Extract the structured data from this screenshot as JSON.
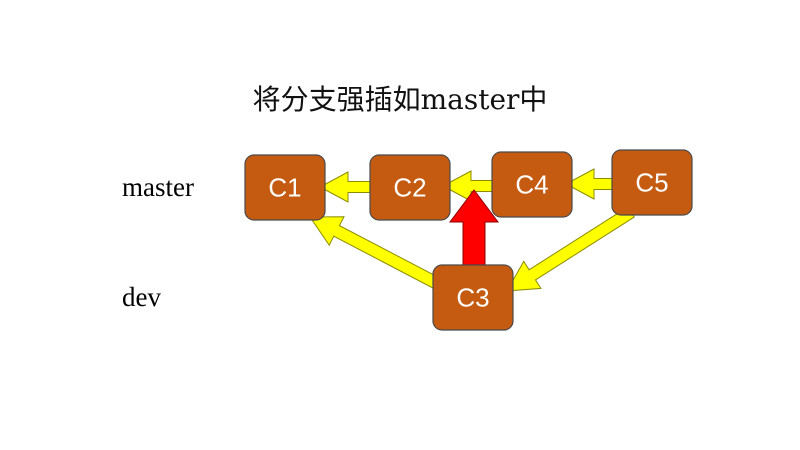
{
  "title": "将分支强插如master中",
  "rows": {
    "master": "master",
    "dev": "dev"
  },
  "commits": [
    {
      "id": "C1",
      "label": "C1",
      "branch": "master"
    },
    {
      "id": "C2",
      "label": "C2",
      "branch": "master"
    },
    {
      "id": "C4",
      "label": "C4",
      "branch": "master"
    },
    {
      "id": "C5",
      "label": "C5",
      "branch": "master"
    },
    {
      "id": "C3",
      "label": "C3",
      "branch": "dev"
    }
  ],
  "edges": [
    {
      "from": "C2",
      "to": "C1",
      "kind": "parent"
    },
    {
      "from": "C4",
      "to": "C2",
      "kind": "parent"
    },
    {
      "from": "C5",
      "to": "C4",
      "kind": "parent"
    },
    {
      "from": "C3",
      "to": "C1",
      "kind": "parent"
    },
    {
      "from": "C5",
      "to": "C3",
      "kind": "parent"
    },
    {
      "from": "C3",
      "to": "C2",
      "kind": "insert"
    }
  ],
  "colors": {
    "node_fill": "#C55A11",
    "node_stroke": "#4A4A4A",
    "node_text": "#FFFFFF",
    "arrow_fill": "#FFFF00",
    "arrow_stroke": "#8C8C00",
    "insert_arrow_fill": "#FF0000",
    "insert_arrow_stroke": "#8B0000"
  }
}
